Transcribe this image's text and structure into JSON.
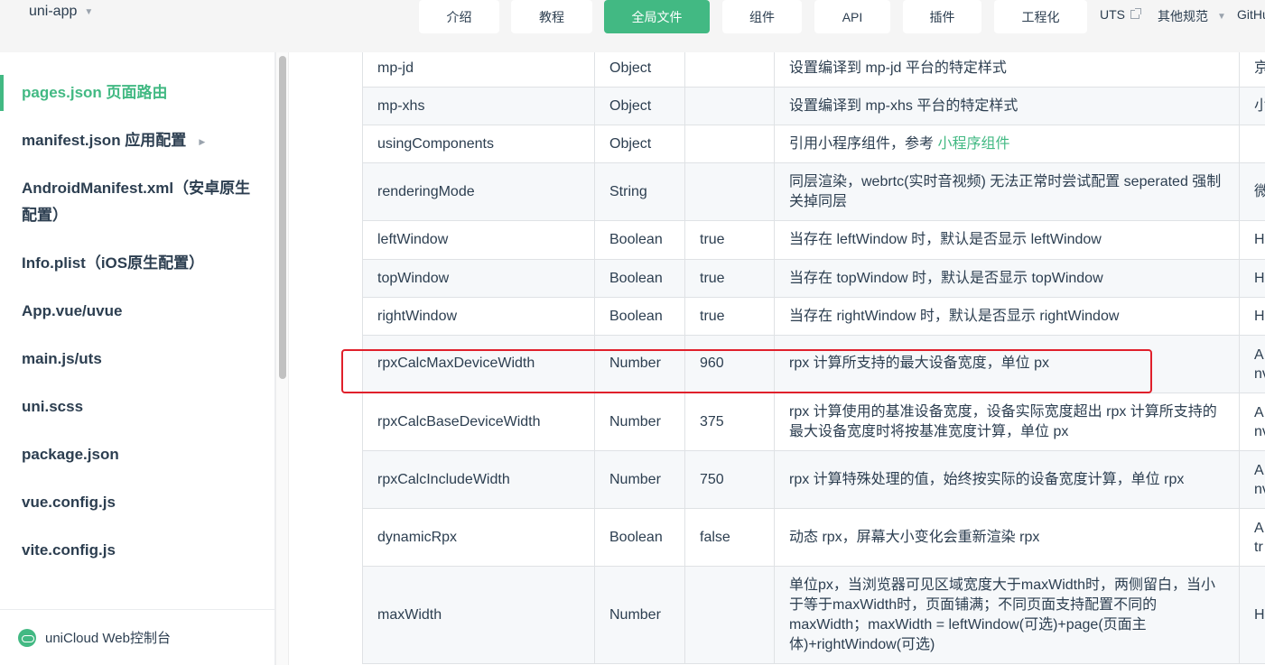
{
  "header": {
    "brand": "uni-app",
    "nav": [
      {
        "label": "介绍",
        "active": false
      },
      {
        "label": "教程",
        "active": false
      },
      {
        "label": "全局文件",
        "active": true
      },
      {
        "label": "组件",
        "active": false
      },
      {
        "label": "API",
        "active": false
      },
      {
        "label": "插件",
        "active": false
      },
      {
        "label": "工程化",
        "active": false
      }
    ],
    "uts": "UTS",
    "other": "其他规范",
    "github": "GitHub"
  },
  "sidebar": {
    "items": [
      {
        "label": "pages.json 页面路由",
        "active": true
      },
      {
        "label": "manifest.json 应用配置",
        "active": false
      },
      {
        "label": "AndroidManifest.xml（安卓原生配置）",
        "active": false
      },
      {
        "label": "Info.plist（iOS原生配置）",
        "active": false
      },
      {
        "label": "App.vue/uvue",
        "active": false
      },
      {
        "label": "main.js/uts",
        "active": false
      },
      {
        "label": "uni.scss",
        "active": false
      },
      {
        "label": "package.json",
        "active": false
      },
      {
        "label": "vue.config.js",
        "active": false
      },
      {
        "label": "vite.config.js",
        "active": false
      }
    ],
    "footer": "uniCloud Web控制台"
  },
  "table": {
    "rows": [
      {
        "name": "mp-jd",
        "type": "Object",
        "default": "",
        "desc": "设置编译到 mp-jd 平台的特定样式",
        "platform": "京"
      },
      {
        "name": "mp-xhs",
        "type": "Object",
        "default": "",
        "desc": "设置编译到 mp-xhs 平台的特定样式",
        "platform": "小"
      },
      {
        "name": "usingComponents",
        "type": "Object",
        "default": "",
        "desc": "引用小程序组件，参考 ",
        "link": "小程序组件",
        "platform": ""
      },
      {
        "name": "renderingMode",
        "type": "String",
        "default": "",
        "desc": "同层渲染，webrtc(实时音视频) 无法正常时尝试配置 seperated 强制关掉同层",
        "platform": "微"
      },
      {
        "name": "leftWindow",
        "type": "Boolean",
        "default": "true",
        "desc": "当存在 leftWindow 时，默认是否显示 leftWindow",
        "platform": "H"
      },
      {
        "name": "topWindow",
        "type": "Boolean",
        "default": "true",
        "desc": "当存在 topWindow 时，默认是否显示 topWindow",
        "platform": "H"
      },
      {
        "name": "rightWindow",
        "type": "Boolean",
        "default": "true",
        "desc": "当存在 rightWindow 时，默认是否显示 rightWindow",
        "platform": "H"
      },
      {
        "name": "rpxCalcMaxDeviceWidth",
        "type": "Number",
        "default": "960",
        "desc": "rpx 计算所支持的最大设备宽度，单位 px",
        "platform": "A\nnv"
      },
      {
        "name": "rpxCalcBaseDeviceWidth",
        "type": "Number",
        "default": "375",
        "desc": "rpx 计算使用的基准设备宽度，设备实际宽度超出 rpx 计算所支持的最大设备宽度时将按基准宽度计算，单位 px",
        "platform": "A\nnv"
      },
      {
        "name": "rpxCalcIncludeWidth",
        "type": "Number",
        "default": "750",
        "desc": "rpx 计算特殊处理的值，始终按实际的设备宽度计算，单位 rpx",
        "platform": "A\nnv"
      },
      {
        "name": "dynamicRpx",
        "type": "Boolean",
        "default": "false",
        "desc": "动态 rpx，屏幕大小变化会重新渲染 rpx",
        "platform": "A\ntr"
      },
      {
        "name": "maxWidth",
        "type": "Number",
        "default": "",
        "desc": "单位px，当浏览器可见区域宽度大于maxWidth时，两侧留白，当小于等于maxWidth时，页面铺满；不同页面支持配置不同的maxWidth；maxWidth = leftWindow(可选)+page(页面主体)+rightWindow(可选)",
        "platform": "H"
      }
    ]
  }
}
